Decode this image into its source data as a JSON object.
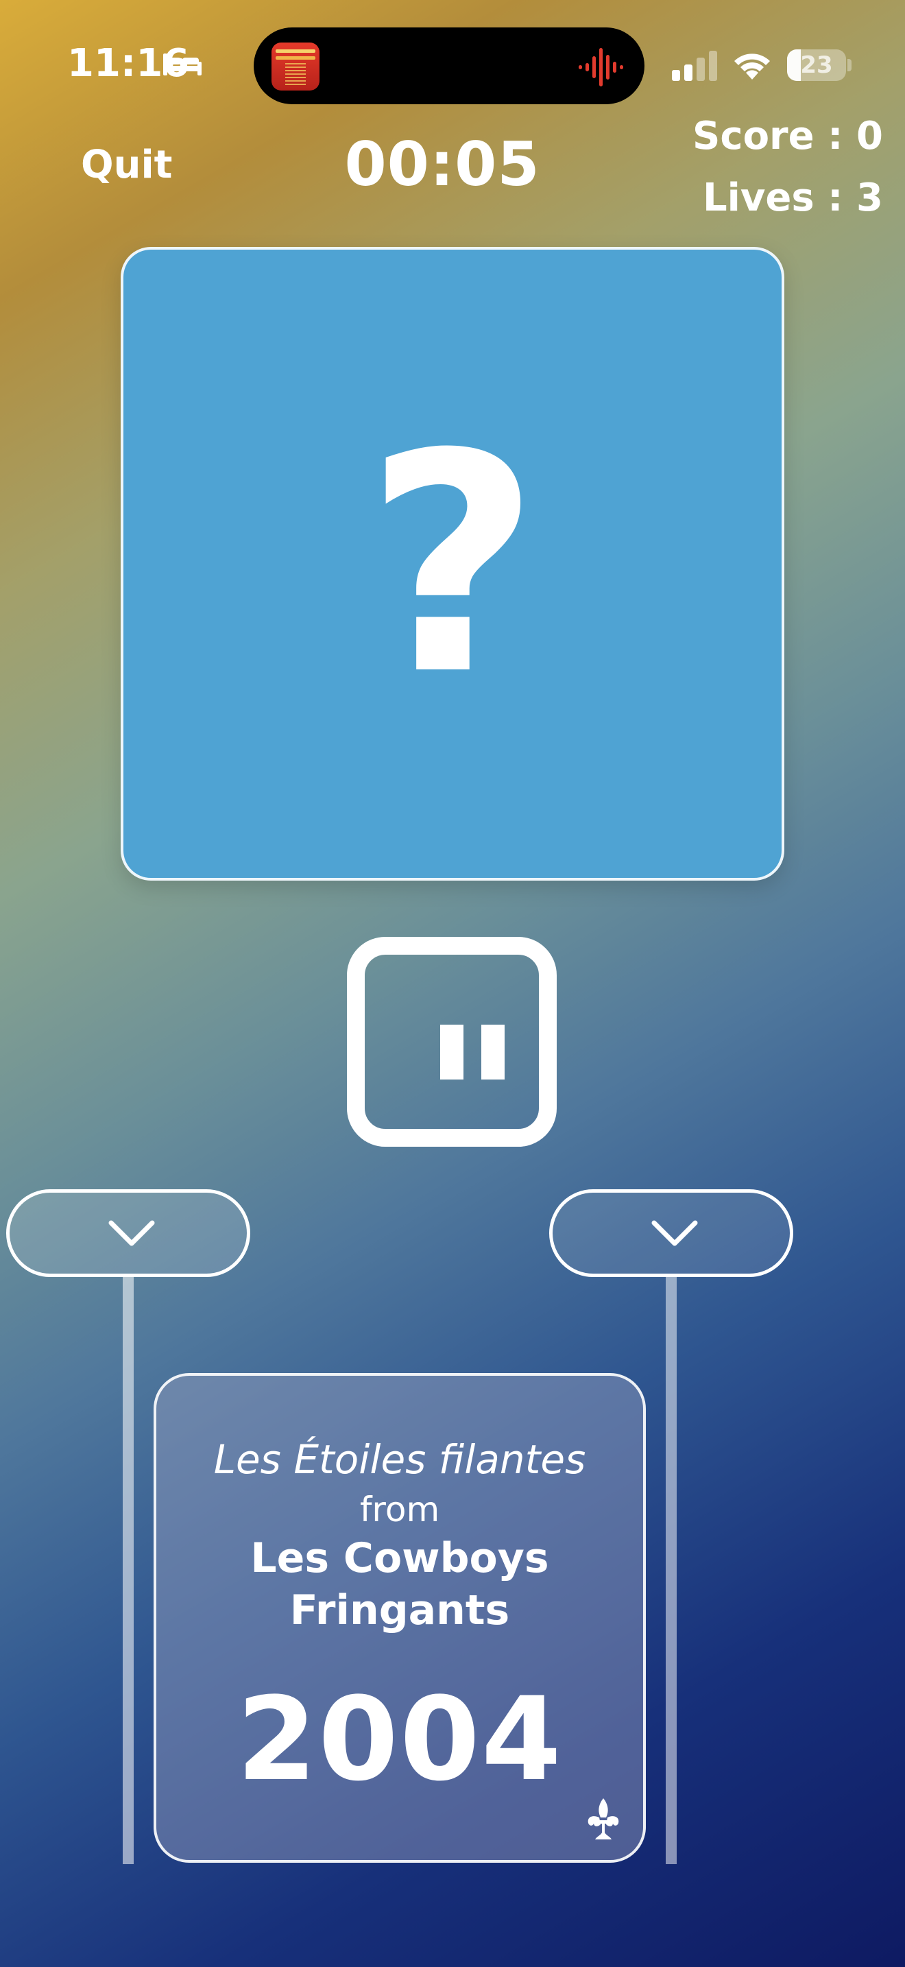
{
  "status_bar": {
    "time": "11:16",
    "battery_percent": "23",
    "battery_level": 0.23,
    "icons": [
      "sleep-bed-icon",
      "cellular-signal-icon",
      "wifi-icon",
      "battery-icon",
      "audio-waveform-icon"
    ]
  },
  "now_playing": {
    "album_art": "album-art"
  },
  "header": {
    "quit_label": "Quit",
    "timer": "00:05",
    "score": "Score : 0",
    "lives": "Lives : 3"
  },
  "mystery_card": {
    "symbol": "?",
    "color": "#4fa3d3"
  },
  "controls": {
    "pause_icon": "pause-icon",
    "left_slot_icon": "chevron-down-icon",
    "right_slot_icon": "chevron-down-icon"
  },
  "timeline_card": {
    "song_title": "Les Étoiles filantes",
    "from_label": "from",
    "artist": "Les Cowboys Fringants",
    "year": "2004",
    "region_icon": "fleur-de-lis-icon"
  }
}
